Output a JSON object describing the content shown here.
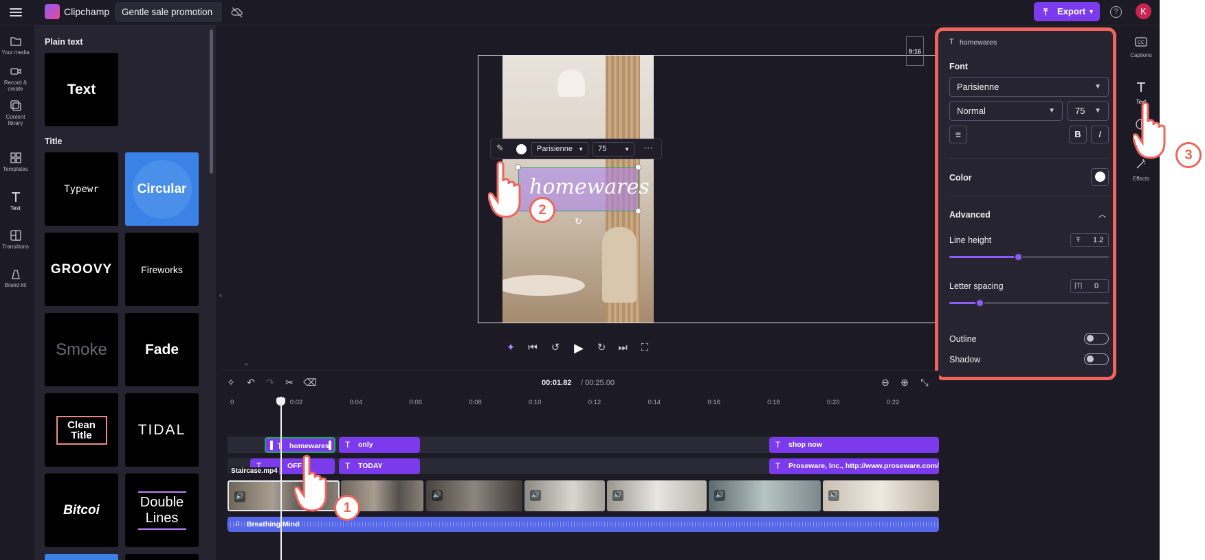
{
  "app": {
    "name": "Clipchamp",
    "project_name": "Gentle sale promotion",
    "export_label": "Export",
    "avatar_initial": "K"
  },
  "left_nav": [
    {
      "label": "Your media",
      "icon": "folder-icon"
    },
    {
      "label": "Record & create",
      "icon": "camera-icon"
    },
    {
      "label": "Content library",
      "icon": "library-icon"
    },
    {
      "label": "Templates",
      "icon": "templates-icon"
    },
    {
      "label": "Text",
      "icon": "text-icon"
    },
    {
      "label": "Transitions",
      "icon": "transitions-icon"
    },
    {
      "label": "Brand kit",
      "icon": "brand-kit-icon"
    }
  ],
  "library": {
    "plain_text_heading": "Plain text",
    "title_heading": "Title",
    "plain_tiles": [
      "Text"
    ],
    "title_tiles": [
      "Typewr",
      "Circular",
      "GROOVY",
      "Fireworks",
      "Smoke",
      "Fade",
      "Clean Title",
      "TIDAL",
      "Bitcoi",
      "Double Lines"
    ]
  },
  "preview": {
    "aspect_ratio": "9:16",
    "overlay_text": "homewares",
    "toolbar_font": "Parisienne",
    "toolbar_size": "75"
  },
  "timeline": {
    "current_time": "00:01.82",
    "total_time": "/ 00:25.00",
    "ticks": [
      "0",
      "0:02",
      "0:04",
      "0:06",
      "0:08",
      "0:10",
      "0:12",
      "0:14",
      "0:16",
      "0:18",
      "0:20",
      "0:22"
    ],
    "text_clips_row1": [
      "homewares",
      "only",
      "shop now"
    ],
    "text_clips_row2": [
      "OFF",
      "TODAY",
      "Proseware, Inc., http://www.proseware.com/"
    ],
    "video_track_label": "Staircase.mp4",
    "audio_track_label": "Breathing Mind"
  },
  "properties": {
    "selected_item": "homewares",
    "font_heading": "Font",
    "font_value": "Parisienne",
    "weight_value": "Normal",
    "size_value": "75",
    "bold_label": "B",
    "italic_label": "I",
    "color_heading": "Color",
    "advanced_heading": "Advanced",
    "line_height_label": "Line height",
    "line_height_value": "1.2",
    "line_height_level": 0.43,
    "letter_spacing_label": "Letter spacing",
    "letter_spacing_value": "0",
    "letter_spacing_level": 0.19,
    "outline_label": "Outline",
    "shadow_label": "Shadow"
  },
  "right_rail": [
    {
      "label": "Captions",
      "icon": "captions-icon"
    },
    {
      "label": "Text",
      "icon": "text-icon"
    },
    {
      "label": "",
      "icon": "filters-icon"
    },
    {
      "label": "Effects",
      "icon": "effects-icon"
    }
  ],
  "steps": [
    "1",
    "2",
    "3"
  ],
  "colors": {
    "accent": "#7c3aed",
    "highlight": "#f0645b",
    "audio": "#5566e8"
  }
}
